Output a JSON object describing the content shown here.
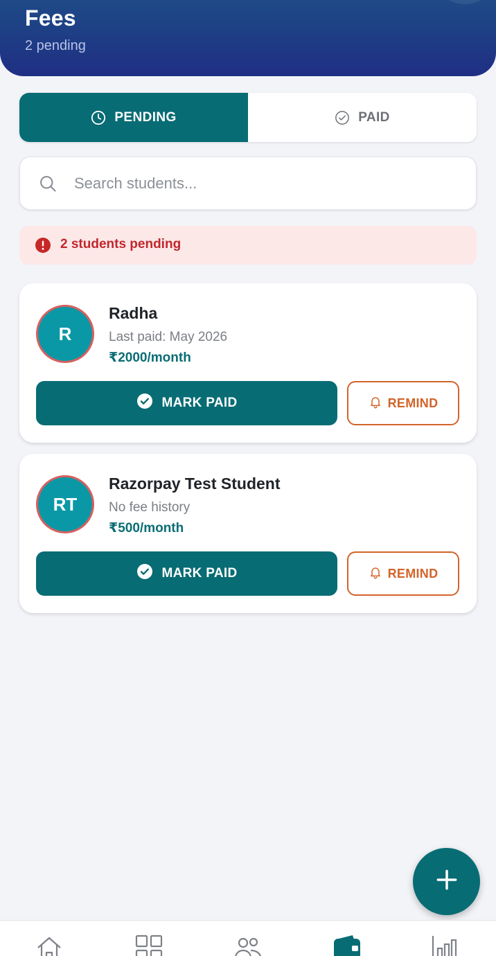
{
  "header": {
    "title": "Fees",
    "subtitle": "2 pending"
  },
  "tabs": [
    {
      "label": "PENDING",
      "icon": "clock-icon",
      "active": true
    },
    {
      "label": "PAID",
      "icon": "check-circle-outline-icon",
      "active": false
    }
  ],
  "search": {
    "placeholder": "Search students...",
    "value": ""
  },
  "alert": {
    "text": "2 students pending",
    "icon": "exclamation-circle-icon",
    "color": "#c0272d"
  },
  "students": [
    {
      "initials": "R",
      "name": "Radha",
      "meta": "Last paid: May 2026",
      "fee": "₹2000/month",
      "mark_paid_label": "MARK PAID",
      "remind_label": "REMIND"
    },
    {
      "initials": "RT",
      "name": "Razorpay Test Student",
      "meta": "No fee history",
      "fee": "₹500/month",
      "mark_paid_label": "MARK PAID",
      "remind_label": "REMIND"
    }
  ],
  "fab": {
    "icon": "plus-icon"
  },
  "bottom_nav": [
    {
      "icon": "home-icon",
      "active": false
    },
    {
      "icon": "grid-icon",
      "active": false
    },
    {
      "icon": "users-icon",
      "active": false
    },
    {
      "icon": "wallet-icon",
      "active": true
    },
    {
      "icon": "bar-chart-icon",
      "active": false
    }
  ],
  "colors": {
    "primary": "#086c74",
    "header": "#1f2f84",
    "remind": "#d2642a",
    "avatar_bg": "#0b98a6",
    "avatar_ring": "#d6605f"
  }
}
